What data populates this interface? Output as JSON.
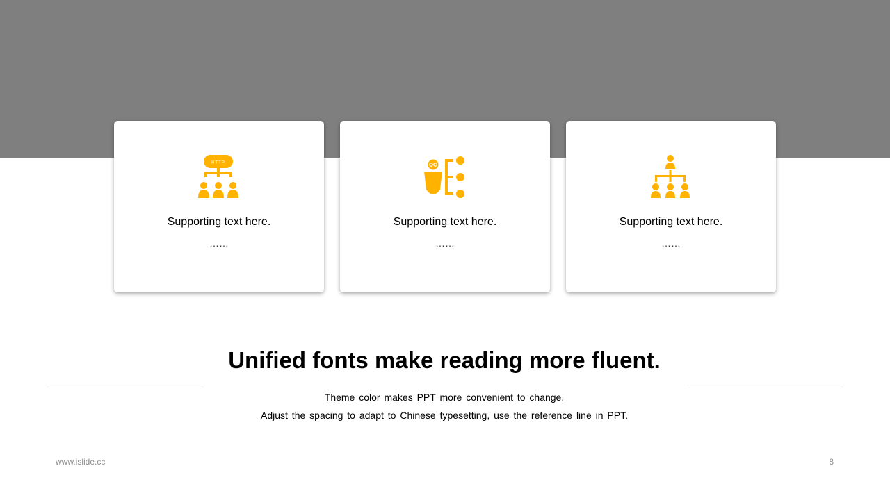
{
  "colors": {
    "accent": "#FFB300",
    "header_band": "#7F7F7F"
  },
  "cards": [
    {
      "icon": "http-network-people-icon",
      "label": "Supporting text here.",
      "dots": "……"
    },
    {
      "icon": "person-options-icon",
      "label": "Supporting text here.",
      "dots": "……"
    },
    {
      "icon": "org-chart-icon",
      "label": "Supporting text here.",
      "dots": "……"
    }
  ],
  "headline": "Unified fonts make reading more fluent.",
  "description": [
    "Theme color makes PPT more convenient to change.",
    "Adjust the spacing to adapt to Chinese typesetting, use the reference line in PPT."
  ],
  "footer": {
    "url": "www.islide.cc",
    "page_number": "8"
  }
}
